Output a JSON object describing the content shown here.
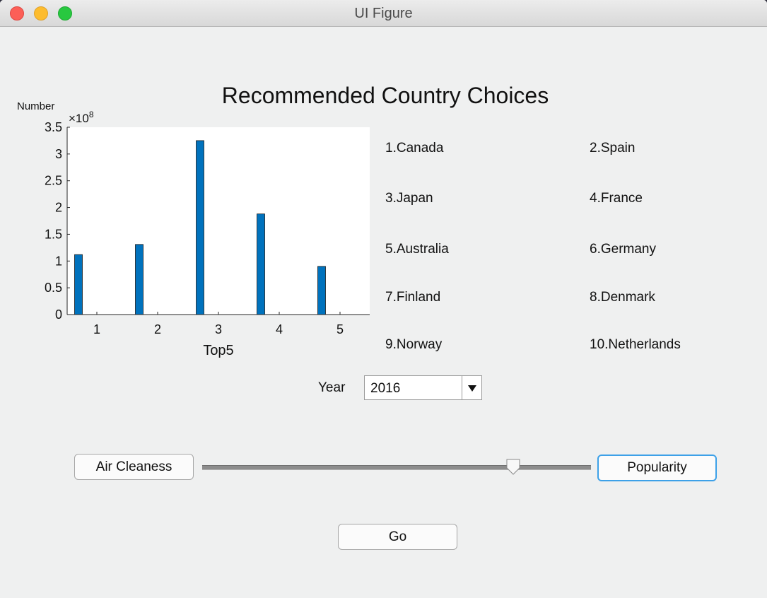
{
  "window": {
    "title": "UI Figure"
  },
  "heading": "Recommended Country Choices",
  "chart_data": {
    "type": "bar",
    "categories": [
      "1",
      "2",
      "3",
      "4",
      "5"
    ],
    "values": [
      112000000,
      131000000,
      325000000,
      188000000,
      90000000
    ],
    "xlabel": "Top5",
    "ylabel": "Number",
    "exponent_label": "×10",
    "exponent_power": "8",
    "ylim": [
      0,
      350000000
    ],
    "yticks": [
      "0",
      "0.5",
      "1",
      "1.5",
      "2",
      "2.5",
      "3",
      "3.5"
    ],
    "bar_color": "#0072bd",
    "grid": false
  },
  "countries": [
    "1.Canada",
    "2.Spain",
    "3.Japan",
    "4.France",
    "5.Australia",
    "6.Germany",
    "7.Finland",
    "8.Denmark",
    "9.Norway",
    "10.Netherlands"
  ],
  "year": {
    "label": "Year",
    "value": "2016"
  },
  "slider": {
    "left_label": "Air Cleaness",
    "right_label": "Popularity",
    "value": 0.8
  },
  "go_label": "Go"
}
